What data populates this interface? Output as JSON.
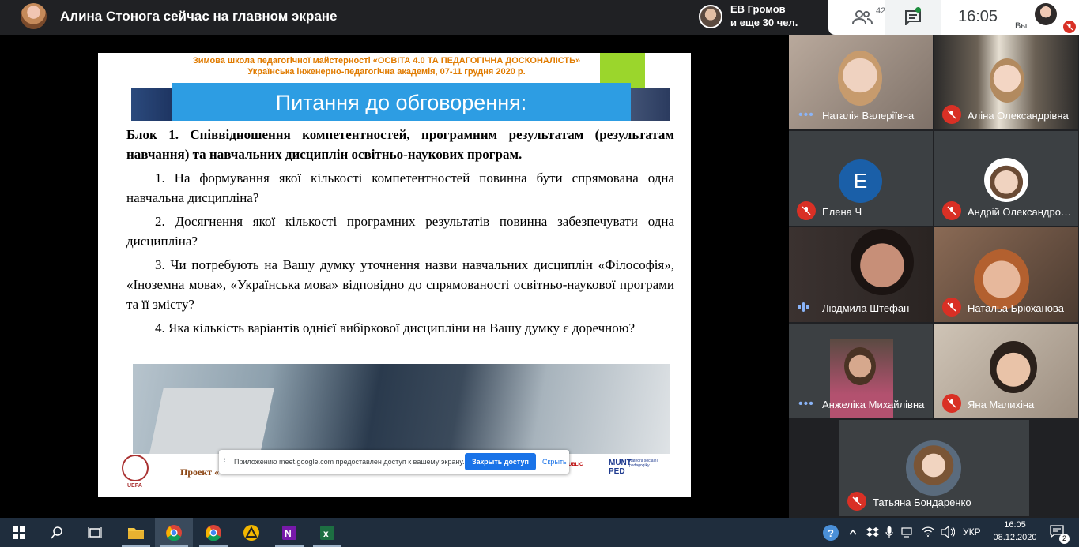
{
  "top_bar": {
    "presenter_text": "Алина Стонога сейчас на главном экране",
    "participants_line1": "ЕВ Громов",
    "participants_line2": "и еще 30 чел.",
    "people_count": "42",
    "time": "16:05",
    "self_label": "Вы"
  },
  "slide": {
    "header_line1": "Зимова школа педагогічної майстерності «ОСВІТА 4.0 ТА ПЕДАГОГІЧНА ДОСКОНАЛІСТЬ»",
    "header_line2": "Українська інженерно-педагогічна академія, 07-11 грудня 2020 р.",
    "banner_title": "Питання до обговорення:",
    "block_title": "Блок 1. Співвідношення компетентностей, програмним результатам (результатам навчання) та навчальних дисциплін освітньо-наукових програм.",
    "questions": [
      "1. На формування якої кількості компетентностей повинна бути спрямована одна навчальна дисципліна?",
      "2. Досягнення якої кількості програмних результатів повинна забезпечувати одна дисципліна?",
      "3. Чи потребують на Вашу думку уточнення назви навчальних дисциплін «Філософія», «Іноземна мова», «Українська мова» відповідно до спрямованості освітньо-наукової програми та її змісту?",
      "4. Яка кількість варіантів однієї вибіркової дисципліни на Вашу думку є доречною?"
    ],
    "footer_text": "Проект «",
    "logo_left_label": "UEPA",
    "logo_public": "UBLIC",
    "logo_munt_line1": "MUNT",
    "logo_munt_line2": "PED",
    "logo_munt_sub": "Katedra sociální pedagogiky"
  },
  "share_bar": {
    "message": "Приложению meet.google.com предоставлен доступ к вашему экрану.",
    "stop_label": "Закрыть доступ",
    "hide_label": "Скрыть"
  },
  "participants": [
    {
      "name": "Наталія Валеріївна",
      "status": "dots"
    },
    {
      "name": "Аліна Олександрівна",
      "status": "muted"
    },
    {
      "name": "Елена Ч",
      "status": "muted",
      "initial": "E"
    },
    {
      "name": "Андрій Олександрович",
      "status": "muted"
    },
    {
      "name": "Людмила Штефан",
      "status": "speaking"
    },
    {
      "name": "Натальа Брюханова",
      "status": "muted"
    },
    {
      "name": "Анжеліка Михайлівна",
      "status": "dots"
    },
    {
      "name": "Яна Малихіна",
      "status": "muted"
    },
    {
      "name": "Татьяна Бондаренко",
      "status": "muted"
    }
  ],
  "taskbar": {
    "language": "УКР",
    "time": "16:05",
    "date": "08.12.2020",
    "notifications": "2"
  }
}
